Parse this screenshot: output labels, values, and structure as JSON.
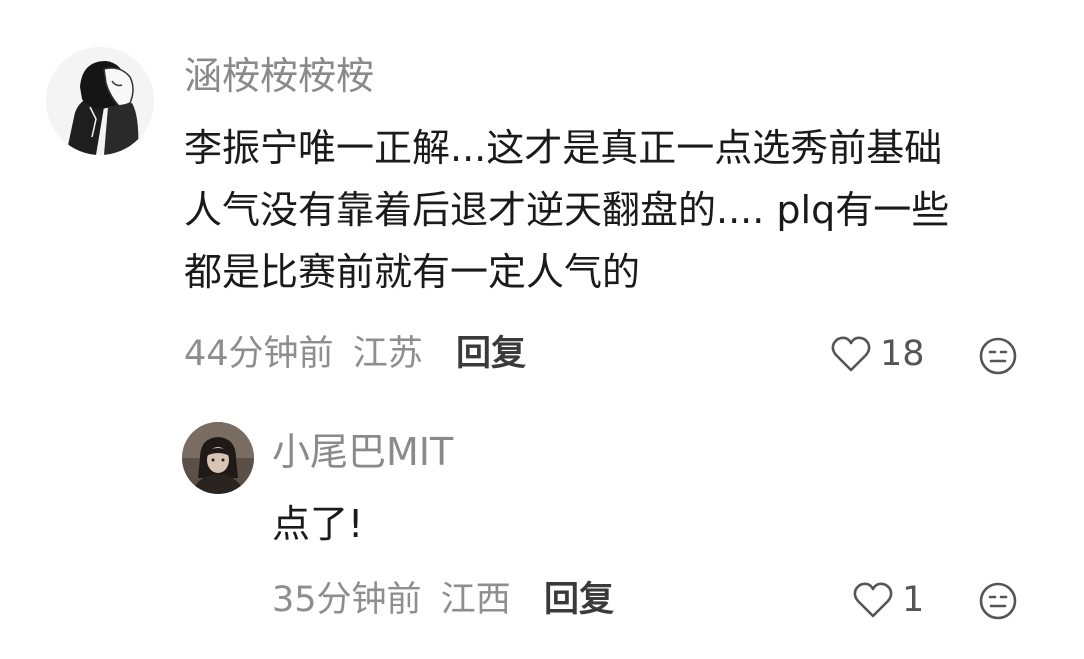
{
  "comment": {
    "username": "涵桉桉桉桉",
    "content_lines": [
      "李振宁唯一正解...这才是真正一点选秀前基础",
      "人气没有靠着后退才逆天翻盘的.... plq有一些",
      "都是比赛前就有一定人气的"
    ],
    "time": "44分钟前",
    "location": "江苏",
    "reply_label": "回复",
    "likes": "18"
  },
  "reply": {
    "username": "小尾巴MIT",
    "content": "点了!",
    "time": "35分钟前",
    "location": "江西",
    "reply_label": "回复",
    "likes": "1"
  },
  "icons": {
    "like": "heart-outline-icon",
    "emoji": "emoji-face-icon"
  },
  "colors": {
    "username": "#8a8a8a",
    "text": "#1a1a1a",
    "meta": "#8e8e8e",
    "icon": "#555555"
  }
}
